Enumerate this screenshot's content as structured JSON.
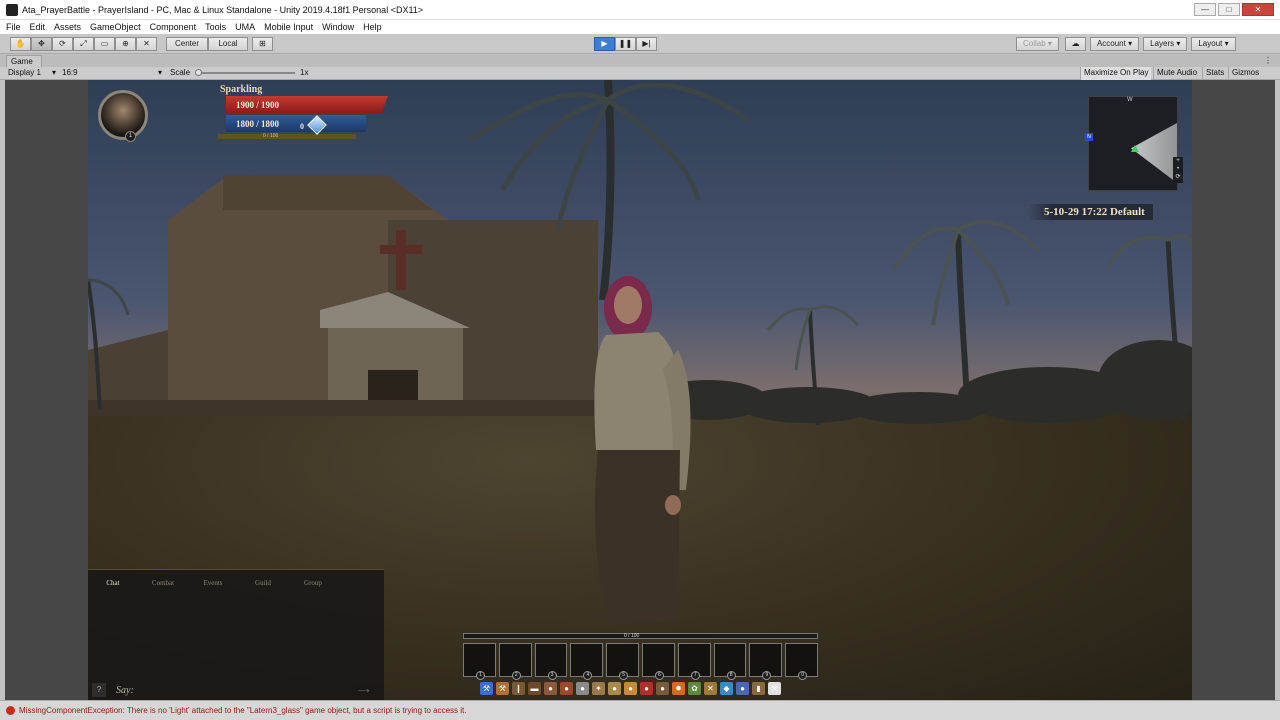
{
  "window": {
    "title": "Ata_PrayerBattle - PrayerIsland - PC, Mac & Linux Standalone - Unity 2019.4.18f1 Personal <DX11>",
    "controls": [
      "—",
      "□",
      "✕"
    ]
  },
  "menu": [
    "File",
    "Edit",
    "Assets",
    "GameObject",
    "Component",
    "Tools",
    "UMA",
    "Mobile Input",
    "Window",
    "Help"
  ],
  "toolbar": {
    "tools": [
      "✋",
      "✥",
      "⟳",
      "⤢",
      "▭",
      "⊕",
      "✕"
    ],
    "pivot": "Center",
    "space": "Local",
    "grid": "⊞",
    "play": "▶",
    "pause": "❚❚",
    "step": "▶|",
    "collab": "Collab",
    "cloud": "☁",
    "account": "Account",
    "layers": "Layers",
    "layout": "Layout"
  },
  "game_tab": {
    "label": "Game",
    "menu": "⋮"
  },
  "game_bar": {
    "display": "Display 1",
    "aspect": "16:9",
    "scale_label": "Scale",
    "scale_value": "1x",
    "maximize": "Maximize On Play",
    "mute": "Mute Audio",
    "stats": "Stats",
    "gizmos": "Gizmos"
  },
  "hud": {
    "player_name": "Sparkling",
    "hp_text": "1900 / 1900",
    "hp_fraction": 1.0,
    "mp_text": "1800 / 1800",
    "mp_fraction": 1.0,
    "xp_text": "0 / 100",
    "level": "1",
    "gems": "0"
  },
  "minimap": {
    "direction_top": "W",
    "direction_left": "N",
    "zoom": "+\n•\n⟳"
  },
  "datetime": "5-10-29 17:22 Default",
  "chat": {
    "tabs": [
      "Chat",
      "Combat",
      "Events",
      "Guild",
      "Group"
    ],
    "placeholder": "Say:",
    "help": "?",
    "send": "⟶"
  },
  "hotbar": {
    "xp_label": "0 / 100",
    "slots": [
      "1",
      "2",
      "3",
      "4",
      "5",
      "6",
      "7",
      "8",
      "9",
      "0"
    ]
  },
  "inventory_icons": [
    {
      "name": "pickaxe-icon",
      "glyph": "⚒",
      "color": "#3a6fd0"
    },
    {
      "name": "hammer-icon",
      "glyph": "⚒",
      "color": "#b07030"
    },
    {
      "name": "torch-icon",
      "glyph": "❙",
      "color": "#7a5a30"
    },
    {
      "name": "wood-icon",
      "glyph": "▬",
      "color": "#6e4a2a"
    },
    {
      "name": "leather-icon",
      "glyph": "●",
      "color": "#8c5a3a"
    },
    {
      "name": "meat-icon",
      "glyph": "●",
      "color": "#9a4a2a"
    },
    {
      "name": "stone-icon",
      "glyph": "●",
      "color": "#8a8a8a"
    },
    {
      "name": "tool-icon",
      "glyph": "✦",
      "color": "#9b7a4a"
    },
    {
      "name": "rope-icon",
      "glyph": "●",
      "color": "#aa8a4a"
    },
    {
      "name": "bread-icon",
      "glyph": "●",
      "color": "#c68a3a"
    },
    {
      "name": "berry-icon",
      "glyph": "●",
      "color": "#b0302a"
    },
    {
      "name": "ore-icon",
      "glyph": "●",
      "color": "#7a5a3a"
    },
    {
      "name": "fire-icon",
      "glyph": "✹",
      "color": "#d46a1a"
    },
    {
      "name": "herb-icon",
      "glyph": "✿",
      "color": "#5a8a3a"
    },
    {
      "name": "axe-icon",
      "glyph": "✕",
      "color": "#a07a3a"
    },
    {
      "name": "fish-icon",
      "glyph": "◆",
      "color": "#3a8ac0"
    },
    {
      "name": "potion-icon",
      "glyph": "●",
      "color": "#4a6ab0"
    },
    {
      "name": "chest-icon",
      "glyph": "▮",
      "color": "#8a6a3a"
    },
    {
      "name": "hammer-white-icon",
      "glyph": "⚒",
      "color": "#e0e0e0"
    }
  ],
  "status": {
    "message": "MissingComponentException: There is no 'Light' attached to the \"Latern3_glass\" game object, but a script is trying to access it."
  }
}
